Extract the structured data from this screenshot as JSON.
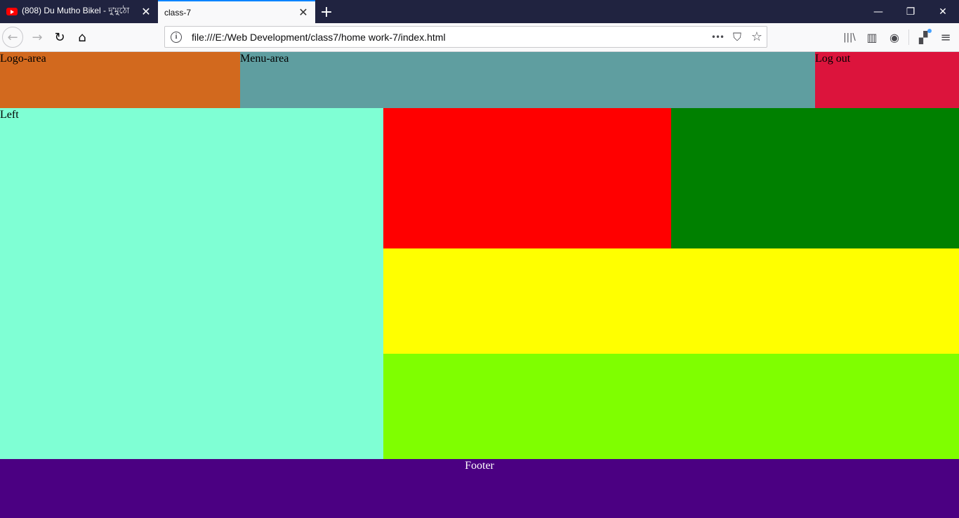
{
  "browser": {
    "tabs": [
      {
        "title": "(808) Du Mutho Bikel - দু'মুঠো",
        "active": false,
        "favicon": "youtube-icon"
      },
      {
        "title": "class-7",
        "active": true
      }
    ],
    "new_tab_symbol": "+",
    "window_controls": {
      "minimize": "—",
      "restore": "❐",
      "close": "✕"
    },
    "url": "file:///E:/Web Development/class7/home work-7/index.html",
    "icons": {
      "back": "←",
      "forward": "→",
      "reload": "↻",
      "home": "⌂",
      "info": "i",
      "more": "•••",
      "pocket": "⛉",
      "bookmark": "☆",
      "library": "|||\\",
      "sidebar": "▥",
      "account": "◉",
      "extensions": "▞",
      "menu": "≡"
    }
  },
  "page": {
    "logo_area": {
      "label": "Logo-area",
      "color": "#d2691e"
    },
    "menu_area": {
      "label": "Menu-area",
      "color": "#5f9ea0"
    },
    "logout": {
      "label": "Log out",
      "color": "#dc143c"
    },
    "left": {
      "label": "Left",
      "color": "#7fffd4"
    },
    "boxes": {
      "red": "#ff0000",
      "green": "#008000",
      "yellow": "#ffff00",
      "lime": "#7fff00"
    },
    "footer": {
      "label": "Footer",
      "color": "#4b0082"
    }
  }
}
